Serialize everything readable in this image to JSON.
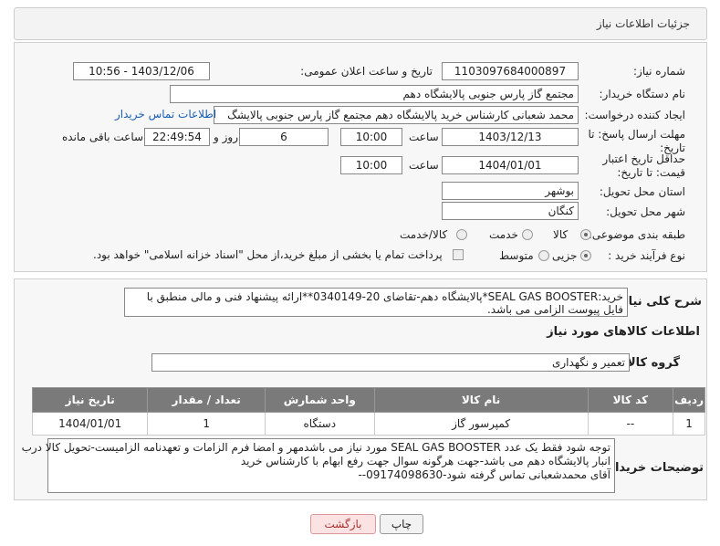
{
  "header": {
    "title": "جزئیات اطلاعات نیاز"
  },
  "fields": {
    "need_number_label": "شماره نیاز:",
    "need_number": "1103097684000897",
    "announce_label": "تاریخ و ساعت اعلان عمومی:",
    "announce_value": "1403/12/06 - 10:56",
    "buyer_org_label": "نام دستگاه خریدار:",
    "buyer_org": "مجتمع گاز پارس جنوبی  پالایشگاه دهم",
    "creator_label": "ایجاد کننده درخواست:",
    "creator": "محمد شعبانی کارشناس خرید پالایشگاه دهم  مجتمع گاز پارس جنوبی  پالایشگ",
    "contact_link": "اطلاعات تماس خریدار",
    "deadline_label": "مهلت ارسال پاسخ: تا تاریخ:",
    "deadline_date": "1403/12/13",
    "time_label": "ساعت",
    "deadline_time": "10:00",
    "days_value": "6",
    "days_label": "روز و",
    "remaining_time": "22:49:54",
    "remaining_label": "ساعت باقی مانده",
    "validity_label": "حداقل تاریخ اعتبار قیمت: تا تاریخ:",
    "validity_date": "1404/01/01",
    "validity_time": "10:00",
    "province_label": "استان محل تحویل:",
    "province": "بوشهر",
    "city_label": "شهر محل تحویل:",
    "city": "کنگان",
    "category_label": "طبقه بندی موضوعی:",
    "category_options": [
      "کالا",
      "خدمت",
      "کالا/خدمت"
    ],
    "process_label": "نوع فرآیند خرید :",
    "process_options": [
      "جزیی",
      "متوسط"
    ],
    "payment_note": "پرداخت تمام یا بخشی از مبلغ خرید،از محل \"اسناد خزانه اسلامی\" خواهد بود."
  },
  "description": {
    "label": "شرح کلی نیاز:",
    "text": "خرید:SEAL GAS BOOSTER*پالایشگاه دهم-تقاضای 20-0340149**ارائه پیشنهاد فنی و مالی منطبق با فایل پیوست الزامی می باشد.",
    "goods_info_title": "اطلاعات کالاهای مورد نیاز",
    "goods_group_label": "گروه کالا:",
    "goods_group": "تعمیر و نگهداری"
  },
  "table": {
    "headers": [
      "ردیف",
      "کد کالا",
      "نام کالا",
      "واحد شمارش",
      "تعداد / مقدار",
      "تاریخ نیاز"
    ],
    "rows": [
      {
        "row": "1",
        "code": "--",
        "name": "کمپرسور گاز",
        "unit": "دستگاه",
        "qty": "1",
        "date": "1404/01/01"
      }
    ]
  },
  "buyer_notes": {
    "label": "توضیحات خریدار:",
    "line1": "توجه شود فقط یک عدد SEAL GAS BOOSTER مورد نیاز می باشدمهر و امضا فرم الزامات و تعهدنامه الزامیست-تحویل کالا درب",
    "line2": "انبار پالایشگاه دهم می باشد-جهت هرگونه سوال جهت رفع ابهام با کارشناس خرید",
    "line3": "آقای محمدشعبانی تماس گرفته شود-09174098630--"
  },
  "buttons": {
    "print": "چاپ",
    "back": "بازگشت"
  }
}
